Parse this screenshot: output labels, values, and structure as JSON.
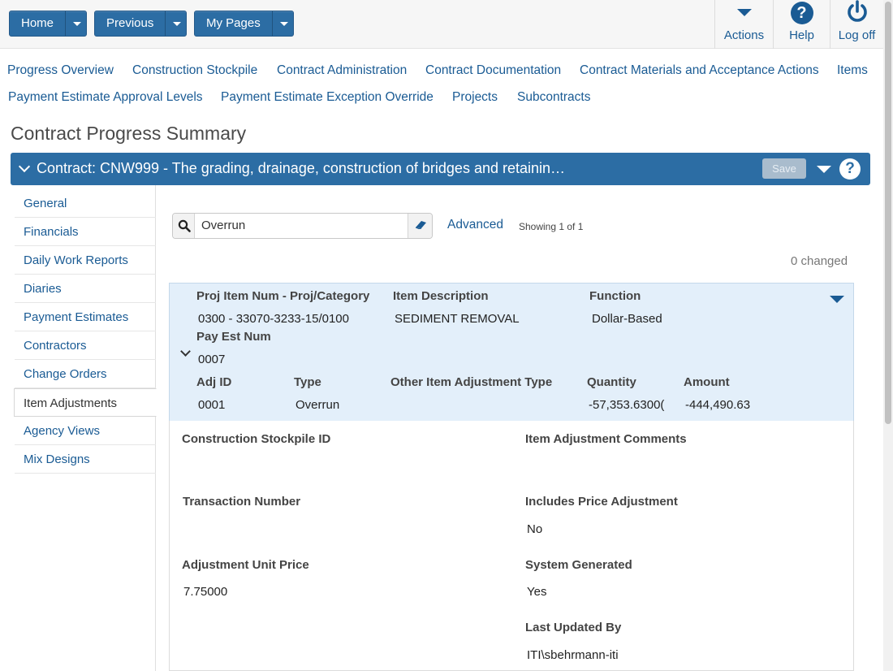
{
  "topnav": {
    "home": "Home",
    "previous": "Previous",
    "mypages": "My Pages",
    "actions": "Actions",
    "help": "Help",
    "logoff": "Log off"
  },
  "links": {
    "row1": [
      "Progress Overview",
      "Construction Stockpile",
      "Contract Administration",
      "Contract Documentation",
      "Contract Materials and Acceptance Actions",
      "Items"
    ],
    "row2": [
      "Payment Estimate Approval Levels",
      "Payment Estimate Exception Override",
      "Projects",
      "Subcontracts"
    ]
  },
  "page_title": "Contract Progress Summary",
  "contract": {
    "title": "Contract: CNW999 - The grading, drainage, construction of bridges and retainin…",
    "save_label": "Save"
  },
  "sidebar": {
    "items": [
      "General",
      "Financials",
      "Daily Work Reports",
      "Diaries",
      "Payment Estimates",
      "Contractors",
      "Change Orders",
      "Item Adjustments",
      "Agency Views",
      "Mix Designs"
    ],
    "active": "Item Adjustments"
  },
  "search": {
    "value": "Overrun",
    "advanced": "Advanced",
    "showing": "Showing 1 of 1",
    "changed": "0 changed"
  },
  "record": {
    "proj_item_label": "Proj Item Num - Proj/Category",
    "proj_item_value": "0300 - 33070-3233-15/0100",
    "desc_label": "Item Description",
    "desc_value": "SEDIMENT REMOVAL",
    "function_label": "Function",
    "function_value": "Dollar-Based",
    "payest_label": "Pay Est Num",
    "payest_value": "0007",
    "adjid_label": "Adj ID",
    "adjid_value": "0001",
    "type_label": "Type",
    "type_value": "Overrun",
    "other_label": "Other Item Adjustment Type",
    "other_value": "",
    "qty_label": "Quantity",
    "qty_value": "-57,353.6300(",
    "amount_label": "Amount",
    "amount_value": "-444,490.63"
  },
  "details": {
    "stockpile_label": "Construction Stockpile ID",
    "stockpile_value": "",
    "comments_label": "Item Adjustment Comments",
    "comments_value": "",
    "transaction_label": "Transaction Number",
    "transaction_value": "",
    "price_adj_label": "Includes Price Adjustment",
    "price_adj_value": "No",
    "unit_price_label": "Adjustment Unit Price",
    "unit_price_value": "7.75000",
    "sysgen_label": "System Generated",
    "sysgen_value": "Yes",
    "updated_label": "Last Updated By",
    "updated_value": "ITI\\sbehrmann-iti"
  }
}
